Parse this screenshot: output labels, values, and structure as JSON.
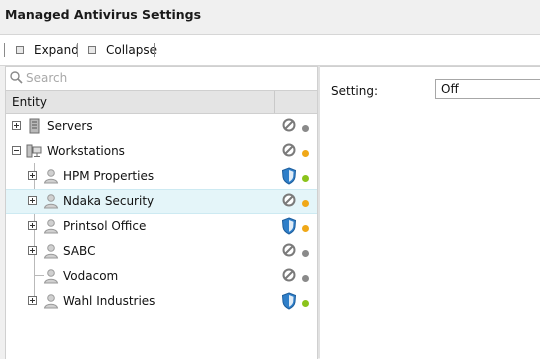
{
  "window": {
    "title": "Managed Antivirus Settings"
  },
  "toolbar": {
    "expand_label": "Expand",
    "collapse_label": "Collapse"
  },
  "search": {
    "placeholder": "Search",
    "value": ""
  },
  "tree": {
    "column_header": "Entity",
    "rows": [
      {
        "label": "Servers",
        "icon": "server-icon",
        "status_icon": "disabled-icon",
        "status_dot": "#8a8a8a",
        "expander": "plus",
        "selected": false
      },
      {
        "label": "Workstations",
        "icon": "workstation-icon",
        "status_icon": "disabled-icon",
        "status_dot": "#f0a818",
        "expander": "minus",
        "selected": false
      },
      {
        "label": "HPM Properties",
        "icon": "user-icon",
        "status_icon": "shield-icon",
        "status_dot": "#8bc31c",
        "expander": "plus",
        "selected": false
      },
      {
        "label": "Ndaka Security",
        "icon": "user-icon",
        "status_icon": "disabled-icon",
        "status_dot": "#f0a818",
        "expander": "plus",
        "selected": true
      },
      {
        "label": "Printsol Office",
        "icon": "user-icon",
        "status_icon": "shield-icon",
        "status_dot": "#f0a818",
        "expander": "plus",
        "selected": false
      },
      {
        "label": "SABC",
        "icon": "user-icon",
        "status_icon": "disabled-icon",
        "status_dot": "#8a8a8a",
        "expander": "plus",
        "selected": false
      },
      {
        "label": "Vodacom",
        "icon": "user-icon",
        "status_icon": "disabled-icon",
        "status_dot": "#8a8a8a",
        "expander": "none",
        "selected": false
      },
      {
        "label": "Wahl Industries",
        "icon": "user-icon",
        "status_icon": "shield-icon",
        "status_dot": "#8bc31c",
        "expander": "plus",
        "selected": false
      }
    ]
  },
  "settings": {
    "setting_label": "Setting:",
    "setting_value": "Off"
  },
  "colors": {
    "selection": "#e4f5f9",
    "shield": "#2f7fc9",
    "green": "#8bc31c",
    "orange": "#f0a818",
    "grey": "#8a8a8a"
  }
}
